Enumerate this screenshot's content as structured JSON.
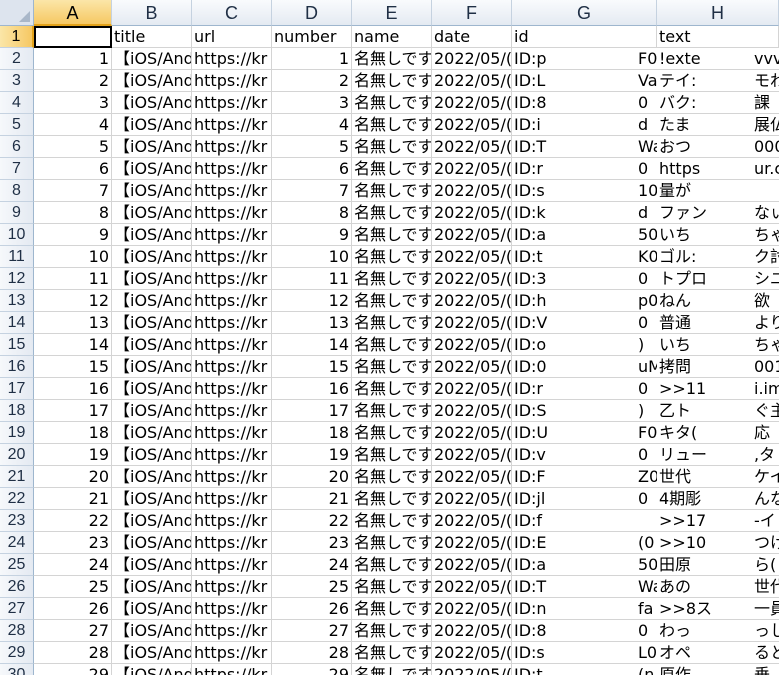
{
  "columns": [
    "A",
    "B",
    "C",
    "D",
    "E",
    "F",
    "G",
    "H"
  ],
  "header_row": [
    "",
    "title",
    "url",
    "number",
    "name",
    "date",
    "id",
    "",
    "text",
    ""
  ],
  "rows": [
    {
      "r": "2",
      "a": "1",
      "b": "【iOS/And",
      "c": "https://kr",
      "d": "1",
      "e": "名無しです",
      "f": "2022/05/(",
      "g": "ID:p",
      "g2": "F0",
      "h": "!exte",
      "h2": "vvv"
    },
    {
      "r": "3",
      "a": "2",
      "b": "【iOS/And",
      "c": "https://kr",
      "d": "2",
      "e": "名無しです",
      "f": "2022/05/(",
      "g": "ID:L",
      "g2": "Va",
      "h": "テイ:",
      "h2": "モわ"
    },
    {
      "r": "4",
      "a": "3",
      "b": "【iOS/And",
      "c": "https://kr",
      "d": "3",
      "e": "名無しです",
      "f": "2022/05/(",
      "g": "ID:8",
      "g2": "0",
      "h": "バク:",
      "h2": "課"
    },
    {
      "r": "5",
      "a": "4",
      "b": "【iOS/And",
      "c": "https://kr",
      "d": "4",
      "e": "名無しです",
      "f": "2022/05/(",
      "g": "ID:i",
      "g2": "d",
      "h": "たま",
      "h2": "展仏"
    },
    {
      "r": "6",
      "a": "5",
      "b": "【iOS/And",
      "c": "https://kr",
      "d": "5",
      "e": "名無しです",
      "f": "2022/05/(",
      "g": "ID:T",
      "g2": "Wa",
      "h": "おつ",
      "h2": "000"
    },
    {
      "r": "7",
      "a": "6",
      "b": "【iOS/And",
      "c": "https://kr",
      "d": "6",
      "e": "名無しです",
      "f": "2022/05/(",
      "g": "ID:r",
      "g2": "0",
      "h": "https",
      "h2": "ur.c"
    },
    {
      "r": "8",
      "a": "7",
      "b": "【iOS/And",
      "c": "https://kr",
      "d": "7",
      "e": "名無しです",
      "f": "2022/05/(",
      "g": "ID:s",
      "g2": "10",
      "h": "量が",
      "h2": ""
    },
    {
      "r": "9",
      "a": "8",
      "b": "【iOS/And",
      "c": "https://kr",
      "d": "8",
      "e": "名無しです",
      "f": "2022/05/(",
      "g": "ID:k",
      "g2": "d",
      "h": "ファン",
      "h2": "なぃ"
    },
    {
      "r": "10",
      "a": "9",
      "b": "【iOS/And",
      "c": "https://kr",
      "d": "9",
      "e": "名無しです",
      "f": "2022/05/(",
      "g": "ID:a",
      "g2": "50",
      "h": "いち",
      "h2": "ちゃ"
    },
    {
      "r": "11",
      "a": "10",
      "b": "【iOS/And",
      "c": "https://kr",
      "d": "10",
      "e": "名無しです",
      "f": "2022/05/(",
      "g": "ID:t",
      "g2": "K0",
      "h": "ゴル:",
      "h2": "ク討"
    },
    {
      "r": "12",
      "a": "11",
      "b": "【iOS/And",
      "c": "https://kr",
      "d": "11",
      "e": "名無しです",
      "f": "2022/05/(",
      "g": "ID:3",
      "g2": "0",
      "h": "トプロ",
      "h2": "シユ"
    },
    {
      "r": "13",
      "a": "12",
      "b": "【iOS/And",
      "c": "https://kr",
      "d": "12",
      "e": "名無しです",
      "f": "2022/05/(",
      "g": "ID:h",
      "g2": "p0",
      "h": "ねん",
      "h2": "欲"
    },
    {
      "r": "14",
      "a": "13",
      "b": "【iOS/And",
      "c": "https://kr",
      "d": "13",
      "e": "名無しです",
      "f": "2022/05/(",
      "g": "ID:V",
      "g2": "0",
      "h": "普通",
      "h2": "より"
    },
    {
      "r": "15",
      "a": "14",
      "b": "【iOS/And",
      "c": "https://kr",
      "d": "14",
      "e": "名無しです",
      "f": "2022/05/(",
      "g": "ID:o",
      "g2": ")",
      "h": "いち",
      "h2": "ちゃ"
    },
    {
      "r": "16",
      "a": "15",
      "b": "【iOS/And",
      "c": "https://kr",
      "d": "15",
      "e": "名無しです",
      "f": "2022/05/(",
      "g": "ID:0",
      "g2": "uM",
      "h": "拷問",
      "h2": "001"
    },
    {
      "r": "17",
      "a": "16",
      "b": "【iOS/And",
      "c": "https://kr",
      "d": "16",
      "e": "名無しです",
      "f": "2022/05/(",
      "g": "ID:r",
      "g2": "0",
      "h": ">>11",
      "h2": "i.im"
    },
    {
      "r": "18",
      "a": "17",
      "b": "【iOS/And",
      "c": "https://kr",
      "d": "17",
      "e": "名無しです",
      "f": "2022/05/(",
      "g": "ID:S",
      "g2": ")",
      "h": "乙ト",
      "h2": "ぐ主"
    },
    {
      "r": "19",
      "a": "18",
      "b": "【iOS/And",
      "c": "https://kr",
      "d": "18",
      "e": "名無しです",
      "f": "2022/05/(",
      "g": "ID:U",
      "g2": "F0",
      "h": "キタ(",
      "h2": "応"
    },
    {
      "r": "20",
      "a": "19",
      "b": "【iOS/And",
      "c": "https://kr",
      "d": "19",
      "e": "名無しです",
      "f": "2022/05/(",
      "g": "ID:v",
      "g2": "0",
      "h": "リュー",
      "h2": ",タ"
    },
    {
      "r": "21",
      "a": "20",
      "b": "【iOS/And",
      "c": "https://kr",
      "d": "20",
      "e": "名無しです",
      "f": "2022/05/(",
      "g": "ID:F",
      "g2": "Z0",
      "h": "世代",
      "h2": "ケイ"
    },
    {
      "r": "22",
      "a": "21",
      "b": "【iOS/And",
      "c": "https://kr",
      "d": "21",
      "e": "名無しです",
      "f": "2022/05/(",
      "g": "ID:jl",
      "g2": "0",
      "h": "4期彫",
      "h2": "んな"
    },
    {
      "r": "23",
      "a": "22",
      "b": "【iOS/And",
      "c": "https://kr",
      "d": "22",
      "e": "名無しです",
      "f": "2022/05/(",
      "g": "ID:f",
      "g2": "",
      "h": ">>17",
      "h2": "-イ"
    },
    {
      "r": "24",
      "a": "23",
      "b": "【iOS/And",
      "c": "https://kr",
      "d": "23",
      "e": "名無しです",
      "f": "2022/05/(",
      "g": "ID:E",
      "g2": "(0",
      "h": ">>10",
      "h2": "つけ"
    },
    {
      "r": "25",
      "a": "24",
      "b": "【iOS/And",
      "c": "https://kr",
      "d": "24",
      "e": "名無しです",
      "f": "2022/05/(",
      "g": "ID:a",
      "g2": "50",
      "h": "田原",
      "h2": "ら("
    },
    {
      "r": "26",
      "a": "25",
      "b": "【iOS/And",
      "c": "https://kr",
      "d": "25",
      "e": "名無しです",
      "f": "2022/05/(",
      "g": "ID:T",
      "g2": "Wa",
      "h": "あの",
      "h2": "世代"
    },
    {
      "r": "27",
      "a": "26",
      "b": "【iOS/And",
      "c": "https://kr",
      "d": "26",
      "e": "名無しです",
      "f": "2022/05/(",
      "g": "ID:n",
      "g2": "fa",
      "h": ">>8ス",
      "h2": "一員"
    },
    {
      "r": "28",
      "a": "27",
      "b": "【iOS/And",
      "c": "https://kr",
      "d": "27",
      "e": "名無しです",
      "f": "2022/05/(",
      "g": "ID:8",
      "g2": "0",
      "h": "わっ",
      "h2": "っし"
    },
    {
      "r": "29",
      "a": "28",
      "b": "【iOS/And",
      "c": "https://kr",
      "d": "28",
      "e": "名無しです",
      "f": "2022/05/(",
      "g": "ID:s",
      "g2": "L0",
      "h": "オペ",
      "h2": "ると"
    },
    {
      "r": "30",
      "a": "29",
      "b": "【iOS/And",
      "c": "https://kr",
      "d": "29",
      "e": "名無しです",
      "f": "2022/05/(",
      "g": "ID:t",
      "g2": "(n",
      "h": "原作",
      "h2": "垂"
    }
  ],
  "selected_cell": "A1"
}
